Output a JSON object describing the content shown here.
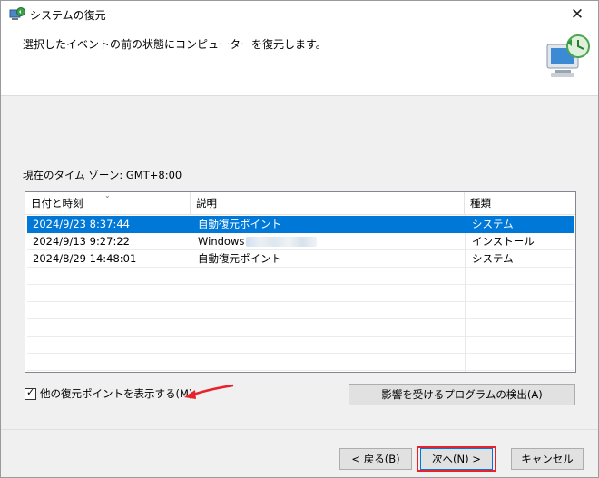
{
  "window": {
    "title": "システムの復元"
  },
  "header": {
    "instruction": "選択したイベントの前の状態にコンピューターを復元します。"
  },
  "timezone_label": "現在のタイム ゾーン: GMT+8:00",
  "list": {
    "columns": [
      "日付と時刻",
      "説明",
      "種類"
    ],
    "rows": [
      {
        "datetime": "2024/9/23 8:37:44",
        "description": "自動復元ポイント",
        "type": "システム",
        "selected": true
      },
      {
        "datetime": "2024/9/13 9:27:22",
        "description": "Windows",
        "type": "インストール",
        "selected": false
      },
      {
        "datetime": "2024/8/29 14:48:01",
        "description": "自動復元ポイント",
        "type": "システム",
        "selected": false
      }
    ]
  },
  "show_more": {
    "label": "他の復元ポイントを表示する(M)",
    "checked": true
  },
  "buttons": {
    "detect": "影響を受けるプログラムの検出(A)",
    "back": "< 戻る(B)",
    "next": "次へ(N) >",
    "cancel": "キャンセル"
  },
  "icons": {
    "close": "close-icon",
    "app": "system-restore-icon",
    "logo": "computer-restore-icon"
  },
  "colors": {
    "selection": "#0078d7",
    "annotation": "#e8222c"
  }
}
